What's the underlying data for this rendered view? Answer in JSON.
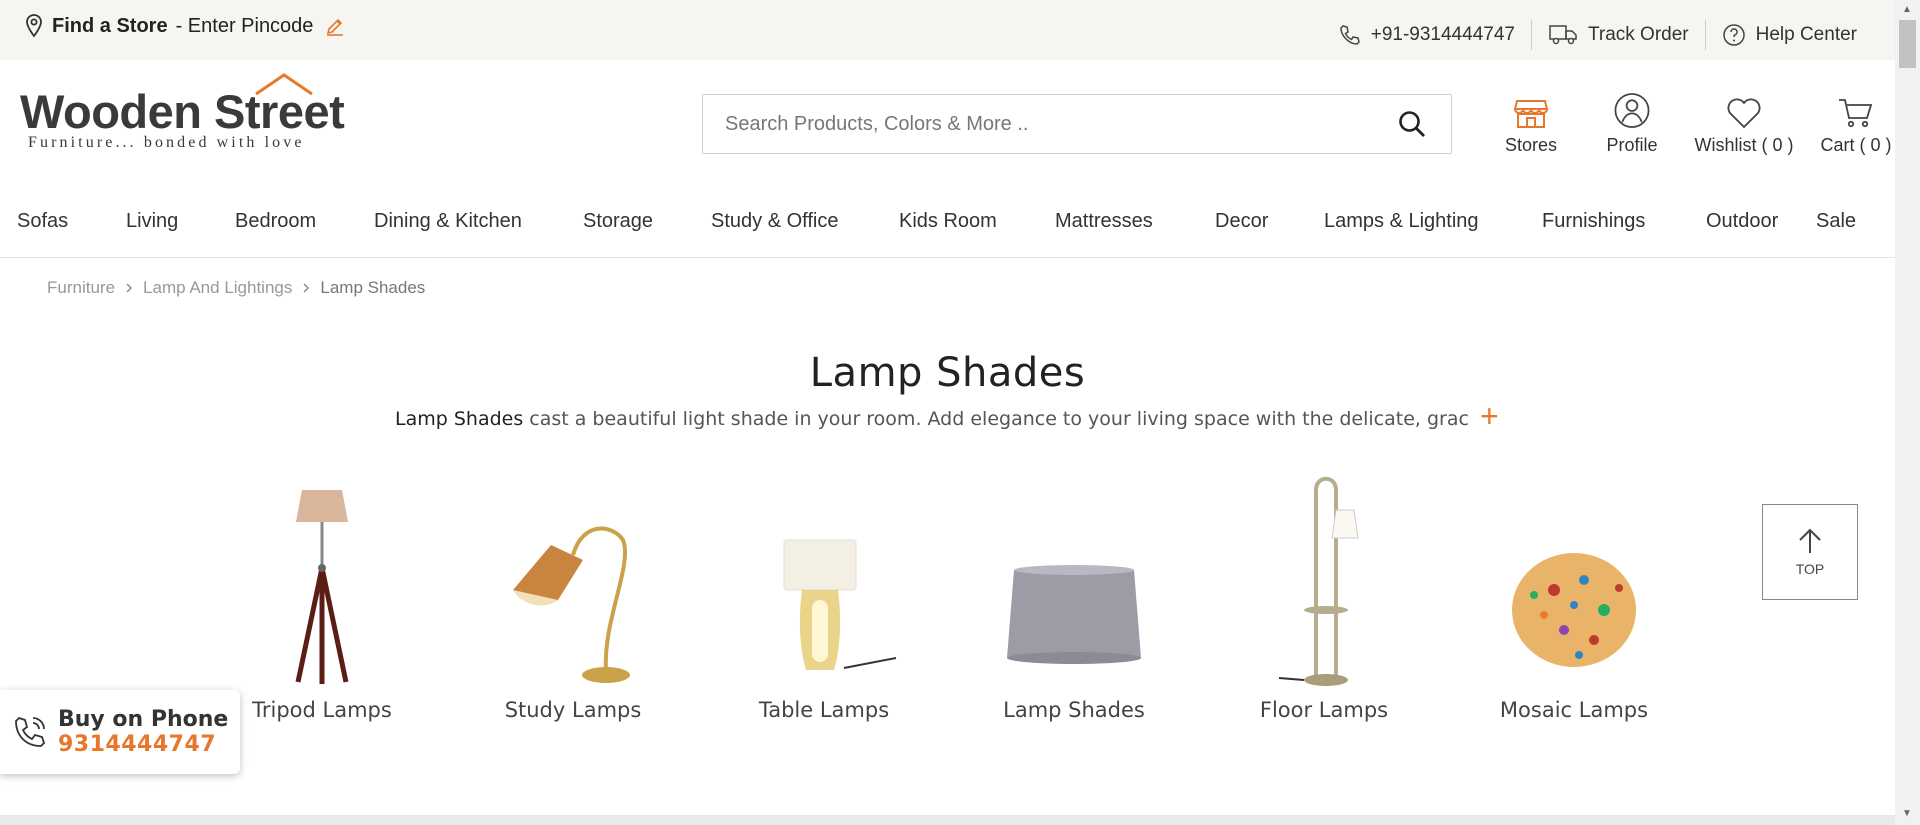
{
  "topbar": {
    "find_store": "Find a Store",
    "enter_pincode": "- Enter Pincode",
    "phone": "+91-9314444747",
    "track_order": "Track Order",
    "help_center": "Help Center"
  },
  "logo": {
    "name": "Wooden Street",
    "tagline": "Furniture... bonded with love"
  },
  "search": {
    "placeholder": "Search Products, Colors & More .."
  },
  "header_icons": {
    "stores": "Stores",
    "profile": "Profile",
    "wishlist": "Wishlist ( 0 )",
    "cart": "Cart ( 0 )"
  },
  "nav": [
    "Sofas",
    "Living",
    "Bedroom",
    "Dining & Kitchen",
    "Storage",
    "Study & Office",
    "Kids Room",
    "Mattresses",
    "Decor",
    "Lamps & Lighting",
    "Furnishings",
    "Outdoor",
    "Sale"
  ],
  "breadcrumb": [
    "Furniture",
    "Lamp And Lightings",
    "Lamp Shades"
  ],
  "page": {
    "title": "Lamp Shades",
    "desc_bold": "Lamp Shades",
    "desc_rest": " cast a beautiful light shade in your room. Add elegance to your living space with the delicate, graceful"
  },
  "categories": [
    "Tripod Lamps",
    "Study Lamps",
    "Table Lamps",
    "Lamp Shades",
    "Floor Lamps",
    "Mosaic Lamps"
  ],
  "top_button": "TOP",
  "buy_on_phone": {
    "label": "Buy on Phone",
    "number": "9314444747"
  },
  "colors": {
    "accent": "#e8772e",
    "topbar_bg": "#f5f5f1"
  }
}
